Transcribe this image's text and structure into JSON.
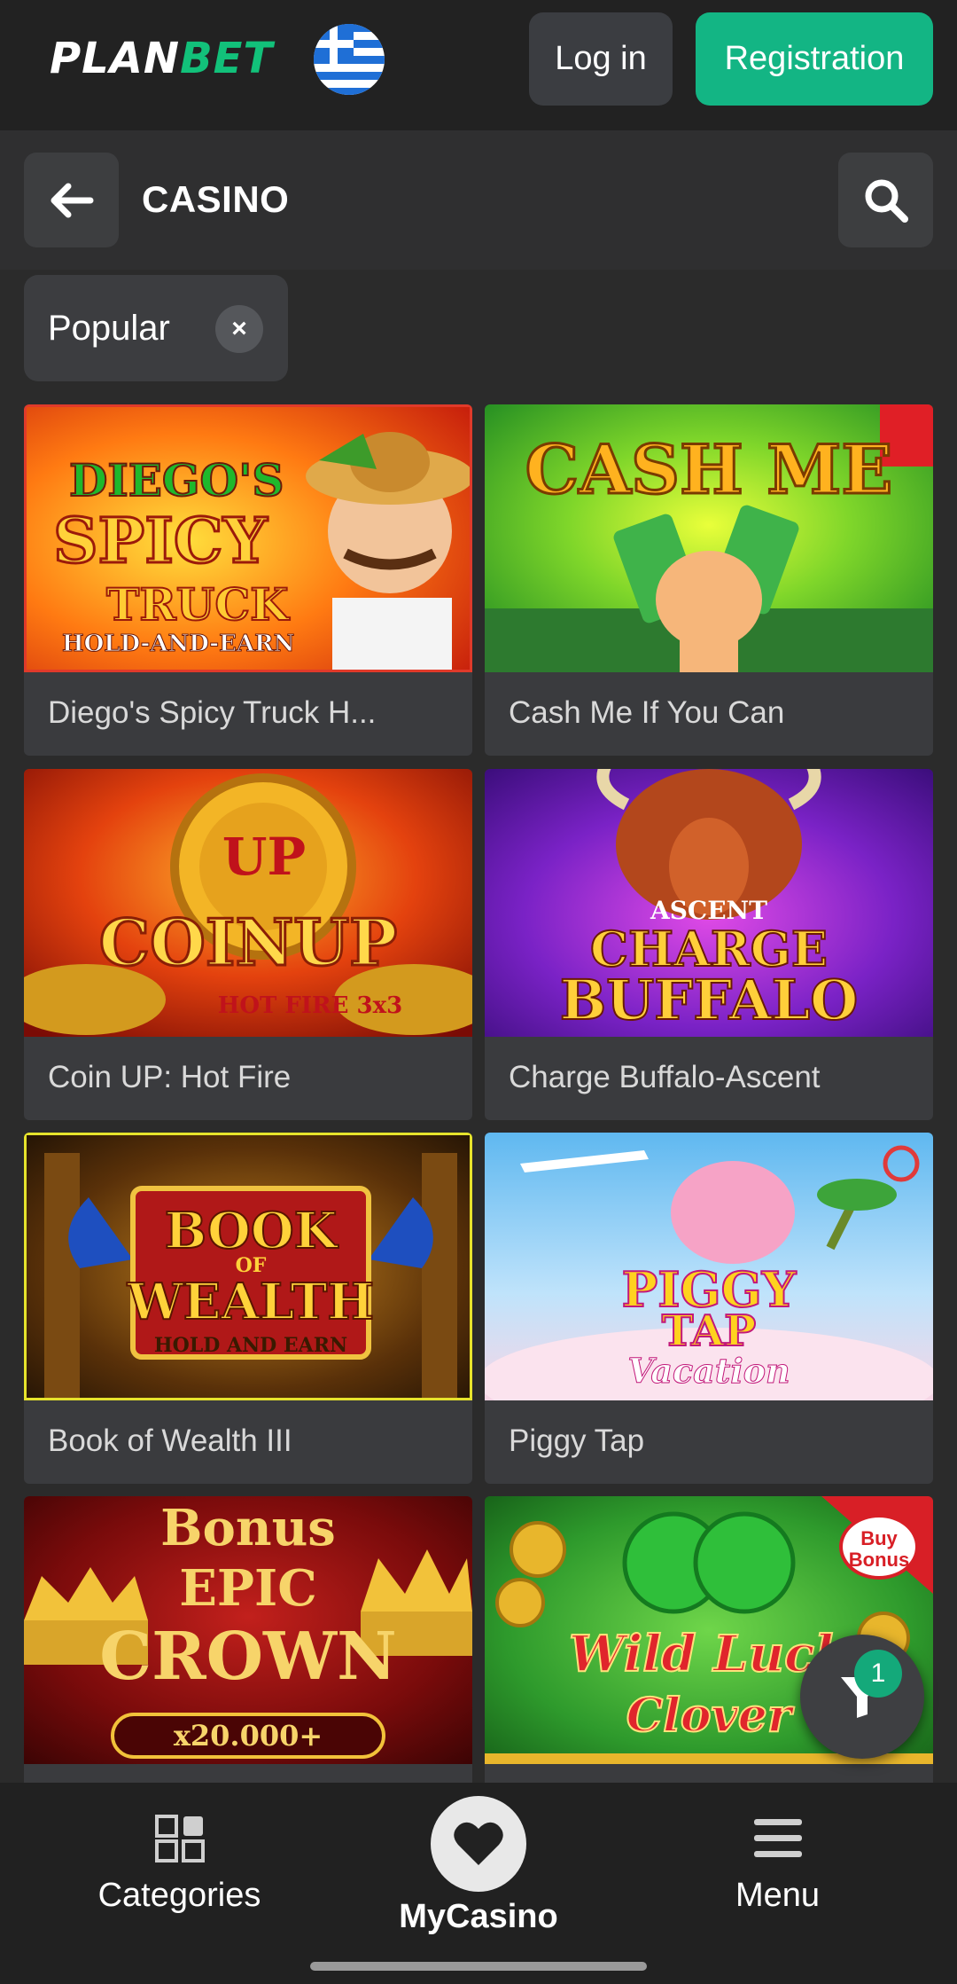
{
  "header": {
    "logo_part1": "PLAN",
    "logo_part2": "BET",
    "flag": "greece-flag-icon",
    "login_label": "Log in",
    "register_label": "Registration"
  },
  "section": {
    "title": "CASINO",
    "back_icon": "arrow-left-icon",
    "search_icon": "search-icon"
  },
  "filter_chip": {
    "label": "Popular",
    "close_glyph": "×"
  },
  "games": [
    {
      "name": "Diego's Spicy Truck H...",
      "art": {
        "line1": "DIEGO'S",
        "line2": "SPICY",
        "line3": "TRUCK",
        "line4": "HOLD-AND-EARN"
      }
    },
    {
      "name": "Cash Me If You Can",
      "art": {
        "line1": "CASH ME"
      }
    },
    {
      "name": "Coin UP: Hot Fire",
      "art": {
        "line1": "UP",
        "line2": "COINUP",
        "line3": "HOT FIRE 3x3"
      }
    },
    {
      "name": "Charge Buffalo-Ascent",
      "art": {
        "line1": "ASCENT",
        "line2": "CHARGE",
        "line3": "BUFFALO"
      }
    },
    {
      "name": "Book of Wealth III",
      "art": {
        "line1": "BOOK",
        "line2": "OF",
        "line3": "WEALTH",
        "line4": "HOLD AND EARN"
      }
    },
    {
      "name": "Piggy Tap",
      "art": {
        "line1": "PIGGY",
        "line2": "TAP",
        "line3": "Vacation"
      }
    },
    {
      "name": "",
      "art": {
        "line1": "Bonus",
        "line2": "EPIC",
        "line3": "CROWN",
        "line4": "x20.000+"
      }
    },
    {
      "name": "",
      "art": {
        "line1": "Wild Luck",
        "line2": "Clover",
        "badge": "Buy Bonus"
      }
    }
  ],
  "fab": {
    "icon": "filter-icon",
    "badge": "1"
  },
  "bottom_nav": {
    "categories_label": "Categories",
    "mycasino_label": "MyCasino",
    "menu_label": "Menu"
  },
  "colors": {
    "brand_green": "#12c17a",
    "register_button": "#13b584",
    "background": "#2b2b2b"
  }
}
